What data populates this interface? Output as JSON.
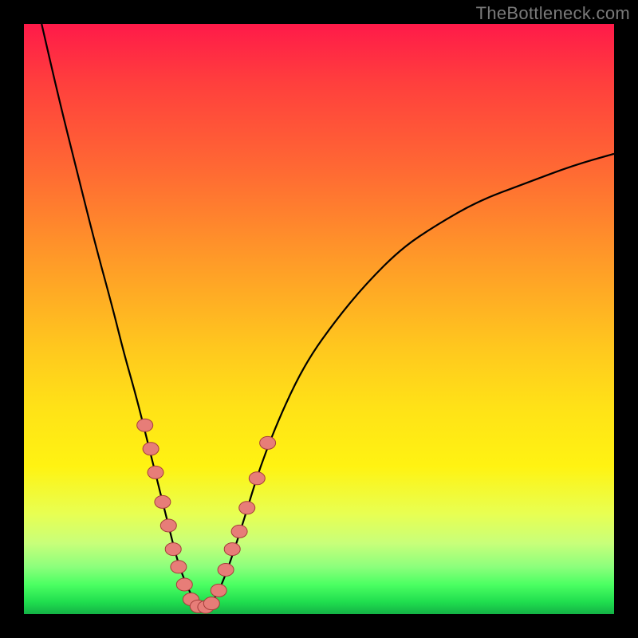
{
  "watermark": "TheBottleneck.com",
  "colors": {
    "curve": "#000000",
    "dot_fill": "#e77d78",
    "dot_stroke": "#a53d3a",
    "background_black": "#000000"
  },
  "chart_data": {
    "type": "line",
    "title": "",
    "xlabel": "",
    "ylabel": "",
    "xlim": [
      0,
      100
    ],
    "ylim": [
      0,
      100
    ],
    "grid": false,
    "legend": false,
    "series": [
      {
        "name": "bottleneck-curve",
        "x": [
          3,
          6,
          9,
          12,
          15,
          17,
          19,
          21,
          23,
          24.5,
          26,
          27.5,
          29,
          30.5,
          32,
          34,
          37,
          40,
          44,
          48,
          53,
          58,
          64,
          70,
          77,
          85,
          93,
          100
        ],
        "y": [
          100,
          87,
          75,
          63,
          52,
          44,
          37,
          29,
          21,
          15,
          9,
          5,
          2,
          1,
          2,
          6,
          15,
          25,
          35,
          43,
          50,
          56,
          62,
          66,
          70,
          73,
          76,
          78
        ]
      }
    ],
    "markers": {
      "name": "highlighted-points",
      "points": [
        {
          "x": 20.5,
          "y": 32
        },
        {
          "x": 21.5,
          "y": 28
        },
        {
          "x": 22.3,
          "y": 24
        },
        {
          "x": 23.5,
          "y": 19
        },
        {
          "x": 24.5,
          "y": 15
        },
        {
          "x": 25.3,
          "y": 11
        },
        {
          "x": 26.2,
          "y": 8
        },
        {
          "x": 27.2,
          "y": 5
        },
        {
          "x": 28.3,
          "y": 2.5
        },
        {
          "x": 29.5,
          "y": 1.3
        },
        {
          "x": 30.8,
          "y": 1.2
        },
        {
          "x": 31.8,
          "y": 1.8
        },
        {
          "x": 33.0,
          "y": 4
        },
        {
          "x": 34.2,
          "y": 7.5
        },
        {
          "x": 35.3,
          "y": 11
        },
        {
          "x": 36.5,
          "y": 14
        },
        {
          "x": 37.8,
          "y": 18
        },
        {
          "x": 39.5,
          "y": 23
        },
        {
          "x": 41.3,
          "y": 29
        }
      ]
    },
    "curve_min_x": 30,
    "curve_min_y": 1
  }
}
